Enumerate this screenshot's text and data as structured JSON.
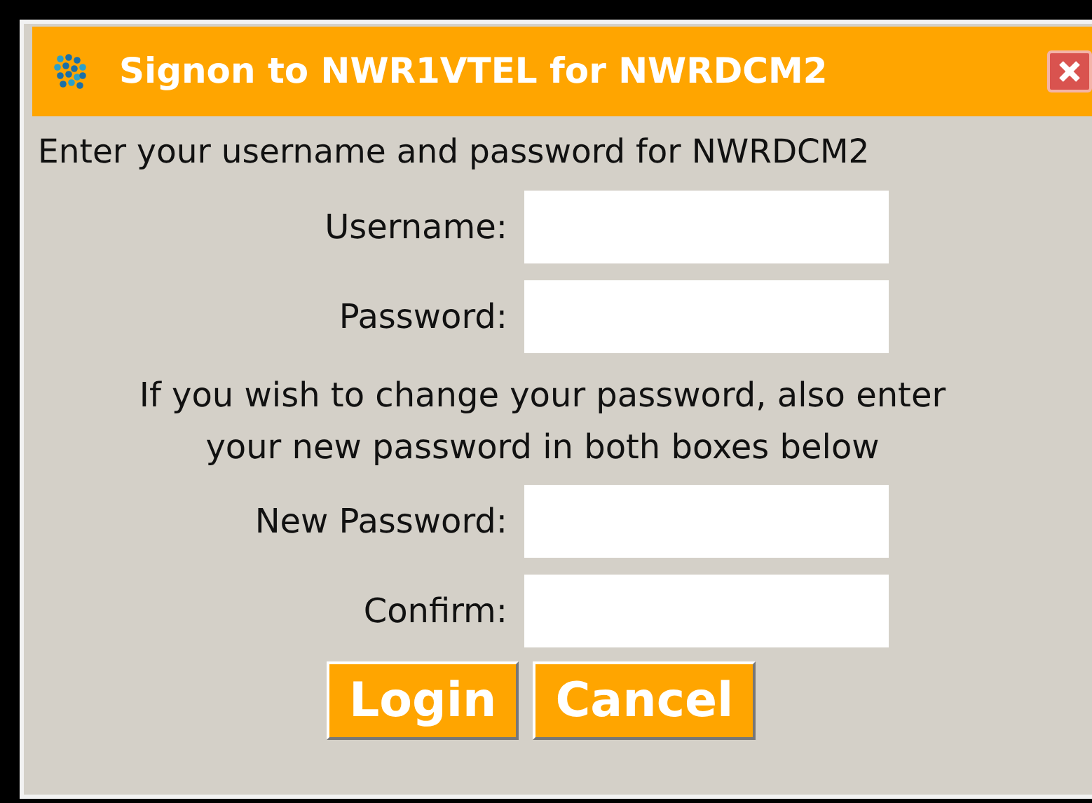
{
  "window": {
    "title": "Signon to NWR1VTEL for NWRDCM2"
  },
  "intro": "Enter your username and password for NWRDCM2",
  "fields": [
    {
      "label": "Username:"
    },
    {
      "label": "Password:"
    }
  ],
  "change_note": "If you wish to change your password, also enter your new password in both boxes below",
  "new_fields": [
    {
      "label": "New Password:"
    },
    {
      "label": "Confirm:"
    }
  ],
  "buttons": [
    "Login",
    "Cancel"
  ]
}
